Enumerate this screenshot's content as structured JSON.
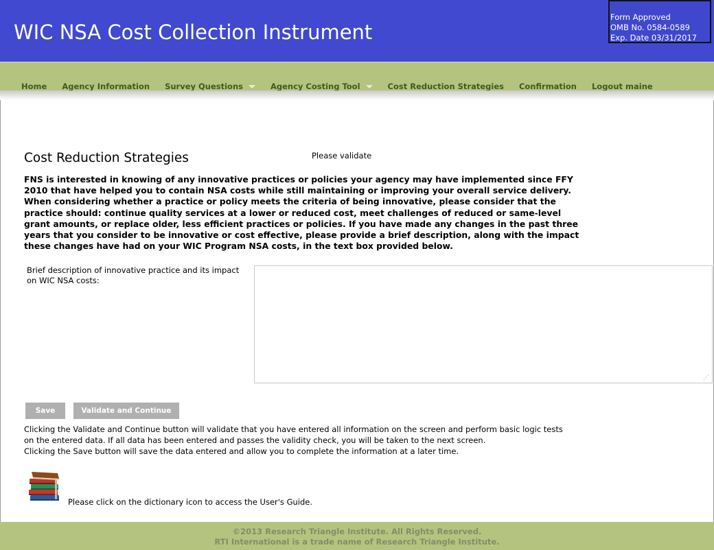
{
  "header": {
    "title": "WIC NSA Cost Collection Instrument",
    "omb": [
      "Form Approved",
      "OMB No. 0584-0589",
      "Exp. Date 03/31/2017"
    ]
  },
  "nav": {
    "items": [
      {
        "label": "Home"
      },
      {
        "label": "Agency Information"
      },
      {
        "label": "Survey Questions"
      },
      {
        "label": "Agency Costing Tool"
      },
      {
        "label": "Cost Reduction Strategies"
      },
      {
        "label": "Confirmation"
      },
      {
        "label": "Logout maine"
      }
    ]
  },
  "main": {
    "title": "Cost Reduction Strategies",
    "validate_message": "Please validate",
    "intro": "FNS is interested in knowing of any innovative practices or policies your agency may have implemented since FFY 2010 that have helped you to contain NSA costs while still maintaining or improving your overall service delivery. When considering whether a practice or policy meets the criteria of being innovative, please consider that the practice should: continue quality services at a lower or reduced cost, meet challenges of reduced or same-level grant amounts, or replace older, less efficient practices or policies. If you have made any changes in the past three years that you consider to be innovative or cost effective, please provide a brief description, along with the impact these changes have had on your WIC Program NSA costs, in the text box provided below.",
    "question_label": "Brief description of innovative practice and its impact on WIC NSA costs:",
    "question_value": ""
  },
  "buttons": {
    "save": "Save",
    "validate": "Validate and Continue"
  },
  "help": {
    "line1": "Clicking the Validate and Continue button will validate that you have entered all information on the screen and perform basic logic tests on the entered data. If all data has been entered and passes the validity check, you will be taken to the next screen.",
    "line2": "Clicking the Save button will save the data entered and allow you to complete the information at a later time.",
    "guide": "Please click on the dictionary icon to access the User's Guide.",
    "icon": "books-icon"
  },
  "footer": {
    "line1": "©2013 Research Triangle Institute. All Rights Reserved.",
    "line2": "RTI International is a trade name of Research Triangle Institute."
  }
}
